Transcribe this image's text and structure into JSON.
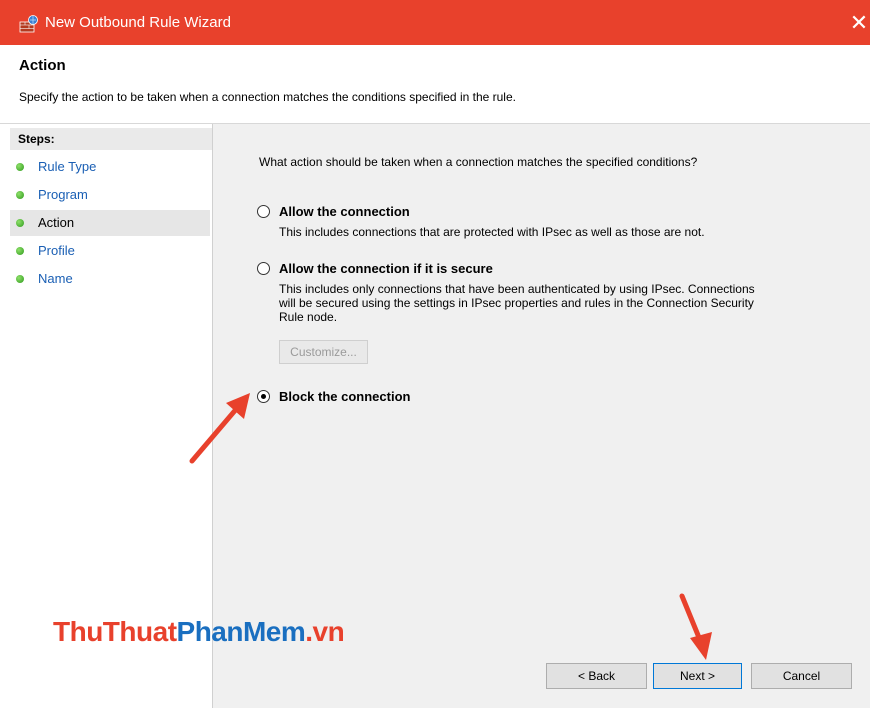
{
  "window": {
    "title": "New Outbound Rule Wizard",
    "close_glyph": "✕"
  },
  "header": {
    "title": "Action",
    "description": "Specify the action to be taken when a connection matches the conditions specified in the rule."
  },
  "steps": {
    "label": "Steps:",
    "items": [
      {
        "label": "Rule Type",
        "active": false
      },
      {
        "label": "Program",
        "active": false
      },
      {
        "label": "Action",
        "active": true
      },
      {
        "label": "Profile",
        "active": false
      },
      {
        "label": "Name",
        "active": false
      }
    ]
  },
  "main": {
    "question": "What action should be taken when a connection matches the specified conditions?",
    "options": [
      {
        "label": "Allow the connection",
        "description": [
          "This includes connections that are protected with IPsec as well as those are not."
        ],
        "selected": false
      },
      {
        "label": "Allow the connection if it is secure",
        "description": [
          "This includes only connections that have been authenticated by using IPsec.  Connections",
          "will be secured using the settings in IPsec properties and rules in the Connection Security",
          "Rule node."
        ],
        "selected": false
      },
      {
        "label": "Block the connection",
        "description": [],
        "selected": true
      }
    ],
    "customize_label": "Customize..."
  },
  "footer": {
    "back_label": "< Back",
    "next_label": "Next >",
    "cancel_label": "Cancel"
  },
  "watermark": {
    "part1": "ThuThuat",
    "part2": "PhanMem",
    "part3": ".vn"
  },
  "colors": {
    "titlebar": "#e8412c",
    "link": "#1a5fb4",
    "annotation_arrow": "#e8412c",
    "watermark_red": "#e8412c",
    "watermark_blue": "#1a6fc0"
  }
}
